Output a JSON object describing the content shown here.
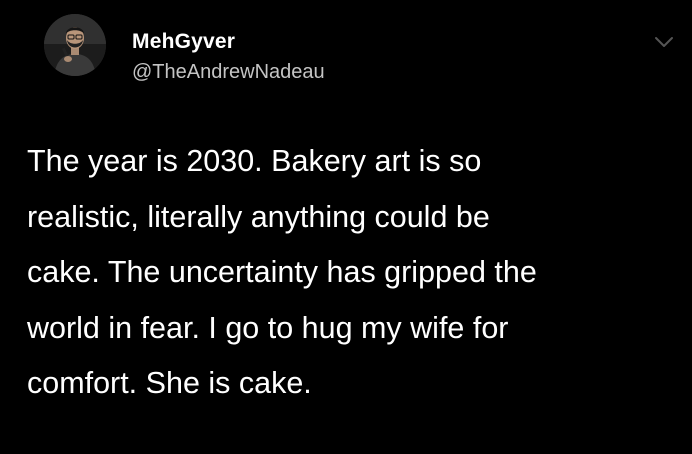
{
  "tweet": {
    "author": {
      "display_name": "MehGyver",
      "handle": "@TheAndrewNadeau",
      "avatar_icon": "comedian-with-microphone-photo"
    },
    "menu_icon": "chevron-down-icon",
    "text_lines": [
      "The year is 2030. Bakery art is so",
      "realistic, literally anything could be",
      "cake. The uncertainty has gripped the",
      "world in fear. I go to hug my wife for",
      "comfort. She is cake."
    ]
  },
  "colors": {
    "background": "#000000",
    "text": "#ffffff",
    "handle": "#c4c4c4",
    "chevron": "#555555"
  }
}
